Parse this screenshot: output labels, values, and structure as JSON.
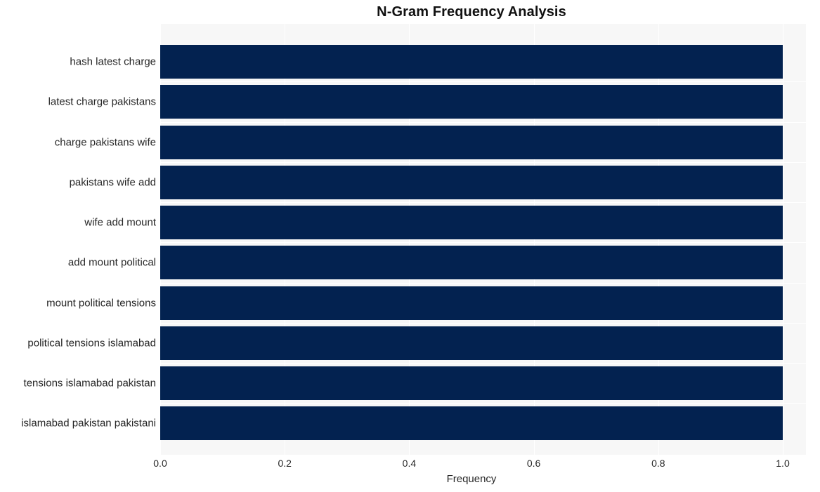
{
  "chart_data": {
    "type": "bar",
    "orientation": "horizontal",
    "title": "N-Gram Frequency Analysis",
    "xlabel": "Frequency",
    "ylabel": "",
    "categories": [
      "hash latest charge",
      "latest charge pakistans",
      "charge pakistans wife",
      "pakistans wife add",
      "wife add mount",
      "add mount political",
      "mount political tensions",
      "political tensions islamabad",
      "tensions islamabad pakistan",
      "islamabad pakistan pakistani"
    ],
    "values": [
      1.0,
      1.0,
      1.0,
      1.0,
      1.0,
      1.0,
      1.0,
      1.0,
      1.0,
      1.0
    ],
    "xlim": [
      0.0,
      1.0
    ],
    "xticks": [
      "0.0",
      "0.2",
      "0.4",
      "0.6",
      "0.8",
      "1.0"
    ],
    "xtick_values": [
      0.0,
      0.2,
      0.4,
      0.6,
      0.8,
      1.0
    ],
    "grid": true,
    "legend": false,
    "bar_color": "#032250",
    "panel_color": "#f7f7f7",
    "grid_color": "#ffffff",
    "background_color": "#ffffff",
    "text_color": "#262626"
  }
}
